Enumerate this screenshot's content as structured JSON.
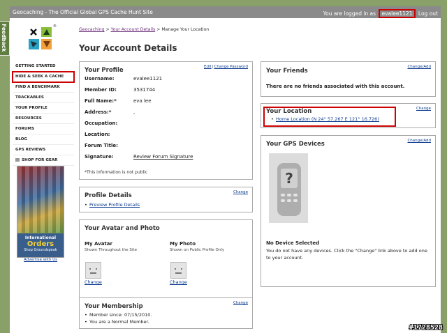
{
  "topbar": {
    "site_title": "Geocaching - The Official Global GPS Cache Hunt Site",
    "logged_in_prefix": "You are logged in as",
    "username": "evalee1121",
    "logout": "Log out"
  },
  "feedback_tab": "Feedback",
  "sidebar": {
    "nav": [
      {
        "label": "GETTING STARTED"
      },
      {
        "label": "HIDE & SEEK A CACHE"
      },
      {
        "label": "FIND A BENCHMARK"
      },
      {
        "label": "TRACKABLES"
      },
      {
        "label": "YOUR PROFILE"
      },
      {
        "label": "RESOURCES"
      },
      {
        "label": "FORUMS"
      },
      {
        "label": "BLOG"
      },
      {
        "label": "GPS REVIEWS"
      },
      {
        "label": "SHOP FOR GEAR"
      }
    ],
    "ad": {
      "line1": "International",
      "line2": "Orders",
      "line3": "Shop Groundspeak"
    },
    "advertise_link": "Advertise with Us"
  },
  "breadcrumb": {
    "home": "Geocaching",
    "account": "Your Account Details",
    "sep": ">",
    "current": "Manage Your Location"
  },
  "page_title": "Your Account Details",
  "profile": {
    "title": "Your Profile",
    "edit": "Edit",
    "sep": "|",
    "change_password": "Change Password",
    "username_label": "Username:",
    "username_value": "evalee1121",
    "member_id_label": "Member ID:",
    "member_id_value": "3531744",
    "full_name_label": "Full Name:*",
    "full_name_value": "eva lee",
    "address_label": "Address:*",
    "address_value": ",",
    "occupation_label": "Occupation:",
    "location_label": "Location:",
    "forum_title_label": "Forum Title:",
    "signature_label": "Signature:",
    "signature_link": "Review Forum Signature",
    "note": "*This information is not public"
  },
  "profile_details": {
    "title": "Profile Details",
    "change": "Change",
    "link": "Preview Profile Details"
  },
  "avatar": {
    "title": "Your Avatar and Photo",
    "avatar_heading": "My Avatar",
    "avatar_sub": "Shown Throughout the Site",
    "avatar_change": "Change",
    "photo_heading": "My Photo",
    "photo_sub": "Shown on Public Profile Only",
    "photo_change": "Change"
  },
  "membership": {
    "title": "Your Membership",
    "change": "Change",
    "since": "Member since: 07/15/2010.",
    "type": "You are a Normal Member."
  },
  "friends": {
    "title": "Your Friends",
    "change": "Change/Add",
    "empty": "There are no friends associated with this account."
  },
  "location": {
    "title": "Your Location",
    "change": "Change",
    "home": "Home Location (N 24° 57.267 E 121° 16.726)"
  },
  "gps": {
    "title": "Your GPS Devices",
    "change": "Change/Add",
    "no_device": "No Device Selected",
    "desc": "You do not have any devices. Click the \"Change\" link above to add one to your account."
  },
  "watermark": "#1728528",
  "colors": {
    "accent_red": "#cc0000",
    "sidebar_green": "#8aa069",
    "topbar_grey": "#8a8a8a"
  }
}
